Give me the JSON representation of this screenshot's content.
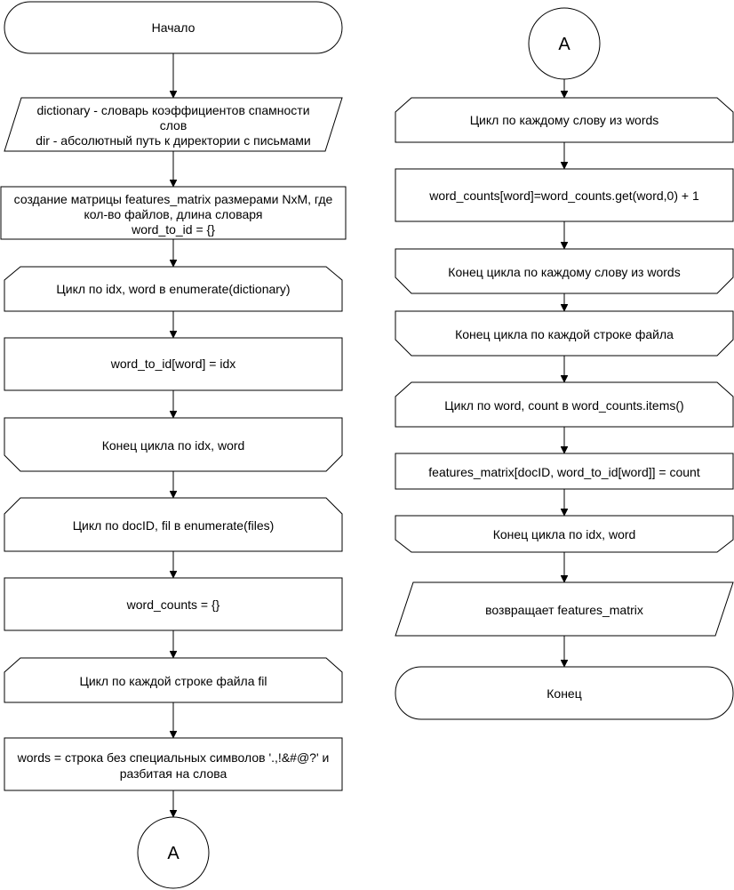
{
  "nodes": {
    "start": {
      "lines": [
        "Начало"
      ]
    },
    "input": {
      "lines": [
        "dictionary -  словарь коэффициентов спамности",
        "слов",
        "dir - абсолютный путь к директории с письмами"
      ]
    },
    "create": {
      "lines": [
        "создание матрицы features_matrix размерами NxM, где",
        "кол-во файлов, длина словаря",
        "word_to_id = {}"
      ]
    },
    "loop1_start": {
      "lines": [
        "Цикл по idx, word в enumerate(dictionary)"
      ]
    },
    "assign_id": {
      "lines": [
        "word_to_id[word] = idx"
      ]
    },
    "loop1_end": {
      "lines": [
        "Конец цикла по idx, word"
      ]
    },
    "loop2_start": {
      "lines": [
        "Цикл по docID, fil в enumerate(files)"
      ]
    },
    "word_counts_init": {
      "lines": [
        "word_counts = {}"
      ]
    },
    "loop3_start": {
      "lines": [
        "Цикл по каждой строке файла fil"
      ]
    },
    "words_split": {
      "lines": [
        "words = строка без специальных символов '.,!&#@?' и",
        "разбитая на слова"
      ]
    },
    "connector_out": {
      "lines": [
        "A"
      ]
    },
    "connector_in": {
      "lines": [
        "A"
      ]
    },
    "loop4_start": {
      "lines": [
        "Цикл по каждому слову из words"
      ]
    },
    "count_word": {
      "lines": [
        "word_counts[word]=word_counts.get(word,0) + 1"
      ]
    },
    "loop4_end": {
      "lines": [
        "Конец цикла по каждому слову из words"
      ]
    },
    "loop3_end": {
      "lines": [
        "Конец цикла по каждой строке файла"
      ]
    },
    "loop5_start": {
      "lines": [
        "Цикл по word, count в word_counts.items()"
      ]
    },
    "fill_matrix": {
      "lines": [
        "features_matrix[docID, word_to_id[word]] = count"
      ]
    },
    "loop5_end": {
      "lines": [
        "Конец цикла по idx, word"
      ]
    },
    "output": {
      "lines": [
        "возвращает features_matrix"
      ]
    },
    "end": {
      "lines": [
        "Конец"
      ]
    }
  }
}
